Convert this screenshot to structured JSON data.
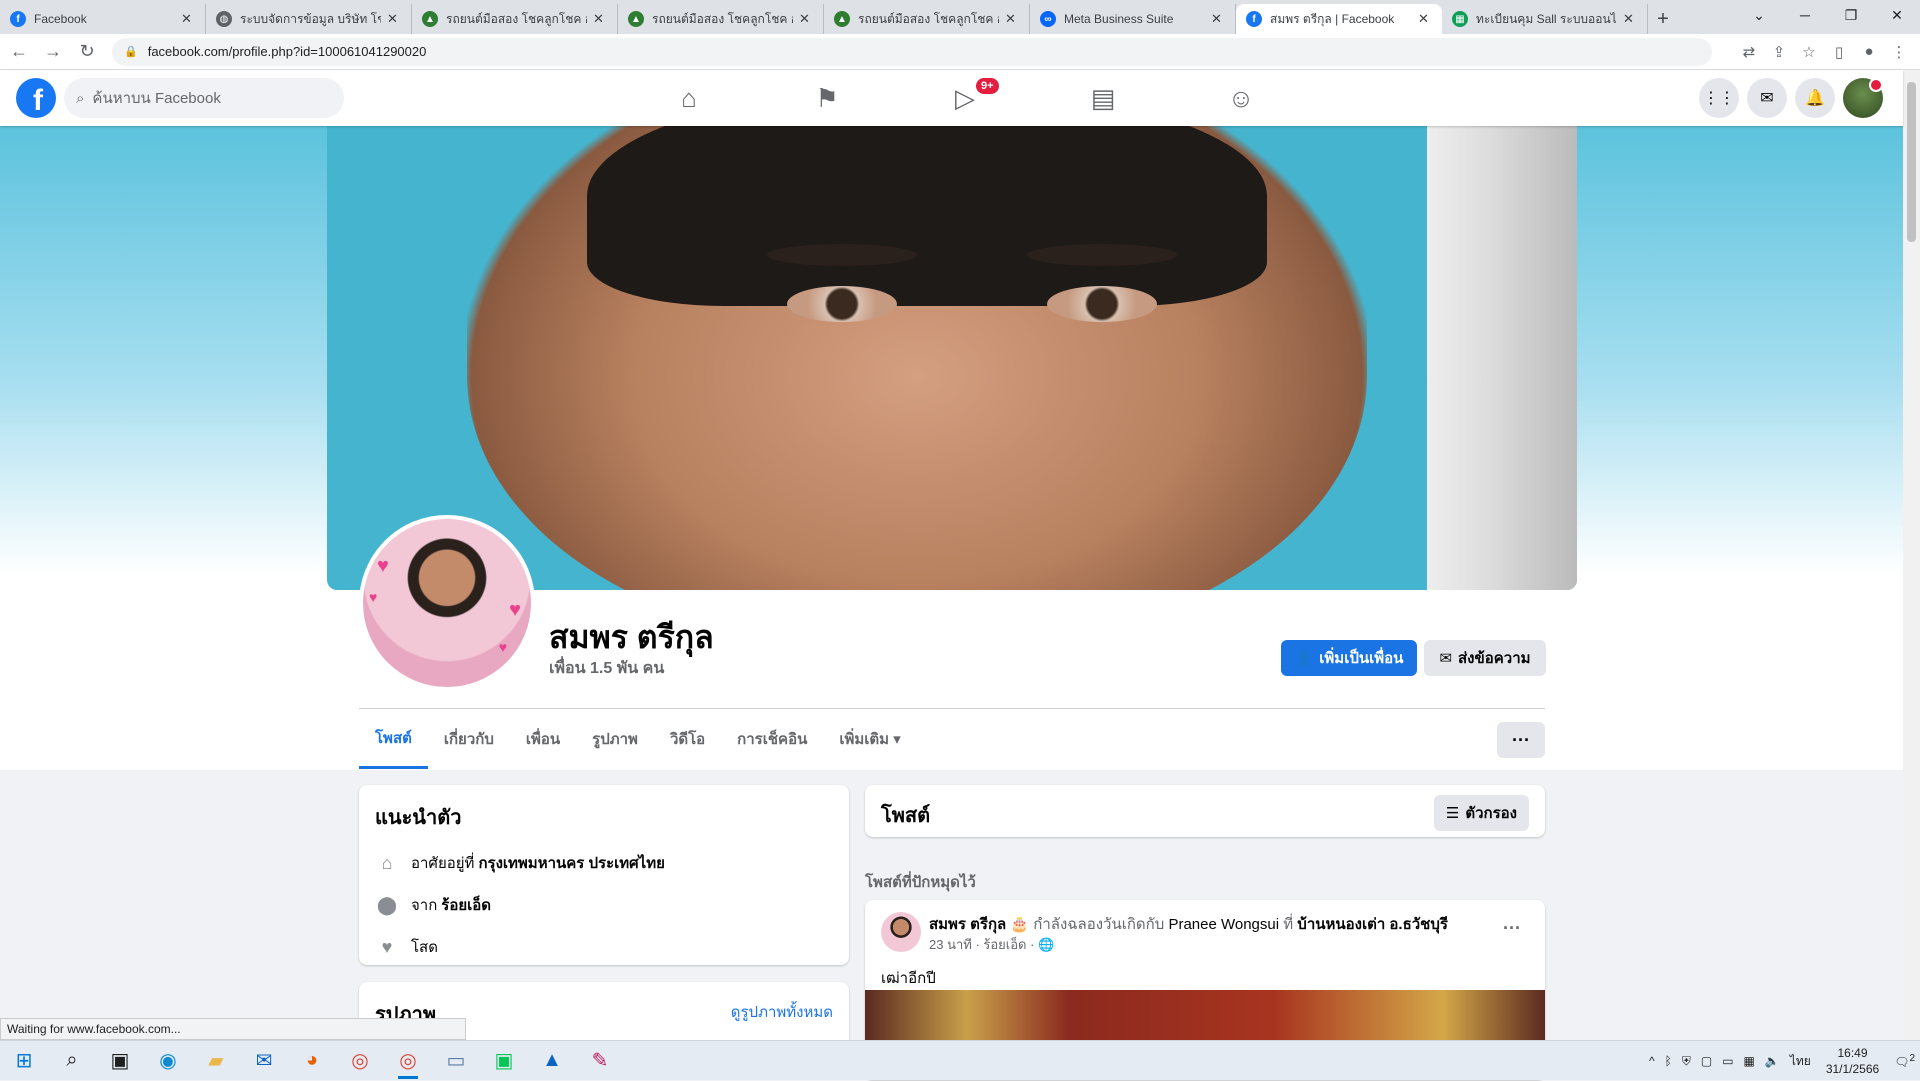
{
  "browser": {
    "tabs": [
      {
        "title": "Facebook",
        "icon": "facebook-icon",
        "color": "#1877f2",
        "active": false
      },
      {
        "title": "ระบบจัดการข้อมูล บริษัท โชคลูกโชค",
        "icon": "globe-icon",
        "color": "#5f6368",
        "active": false
      },
      {
        "title": "รถยนต์มือสอง โชคลูกโชค อุดร",
        "icon": "car-icon",
        "color": "#2e7d32",
        "active": false
      },
      {
        "title": "รถยนต์มือสอง โชคลูกโชค อุดร",
        "icon": "car-icon",
        "color": "#2e7d32",
        "active": false
      },
      {
        "title": "รถยนต์มือสอง โชคลูกโชค อุดร",
        "icon": "car-icon",
        "color": "#2e7d32",
        "active": false
      },
      {
        "title": "Meta Business Suite",
        "icon": "meta-icon",
        "color": "#0866ff",
        "active": false
      },
      {
        "title": "สมพร ตรีกุล | Facebook",
        "icon": "facebook-icon",
        "color": "#1877f2",
        "active": true
      },
      {
        "title": "ทะเบียนคุม Sall ระบบออนไลน์",
        "icon": "sheets-icon",
        "color": "#0f9d58",
        "active": false
      }
    ],
    "url": "facebook.com/profile.php?id=100061041290020",
    "status_text": "Waiting for www.facebook.com..."
  },
  "fb": {
    "search_placeholder": "ค้นหาบน Facebook",
    "video_badge": "9+",
    "profile_name": "สมพร ตรีกุล",
    "friends_count": "เพื่อน 1.5 พัน คน",
    "add_friend_label": "เพิ่มเป็นเพื่อน",
    "message_label": "ส่งข้อความ",
    "tabs": [
      "โพสต์",
      "เกี่ยวกับ",
      "เพื่อน",
      "รูปภาพ",
      "วิดีโอ",
      "การเช็คอิน",
      "เพิ่มเติม"
    ],
    "intro": {
      "title": "แนะนำตัว",
      "lives_prefix": "อาศัยอยู่ที่",
      "lives_value": "กรุงเทพมหานคร ประเทศไทย",
      "from_prefix": "จาก",
      "from_value": "ร้อยเอ็ด",
      "relationship": "โสด"
    },
    "photos": {
      "title": "รูปภาพ",
      "see_all": "ดูรูปภาพทั้งหมด"
    },
    "posts": {
      "title": "โพสต์",
      "filter_label": "ตัวกรอง",
      "pinned_label": "โพสต์ที่ปักหมุดไว้",
      "post": {
        "author": "สมพร ตรีกุล",
        "celebrating": "กำลังฉลองวันเกิดกับ",
        "with_name": "Pranee Wongsui",
        "at": "ที่",
        "place": "บ้านหนองเต่า อ.ธวัชบุรี",
        "meta": "23 นาที · ร้อยเอ็ด ·",
        "text": "เฒ่าอีกปี"
      }
    }
  },
  "taskbar": {
    "lang": "ไทย",
    "time": "16:49",
    "date": "31/1/2566",
    "notif_count": "2"
  }
}
